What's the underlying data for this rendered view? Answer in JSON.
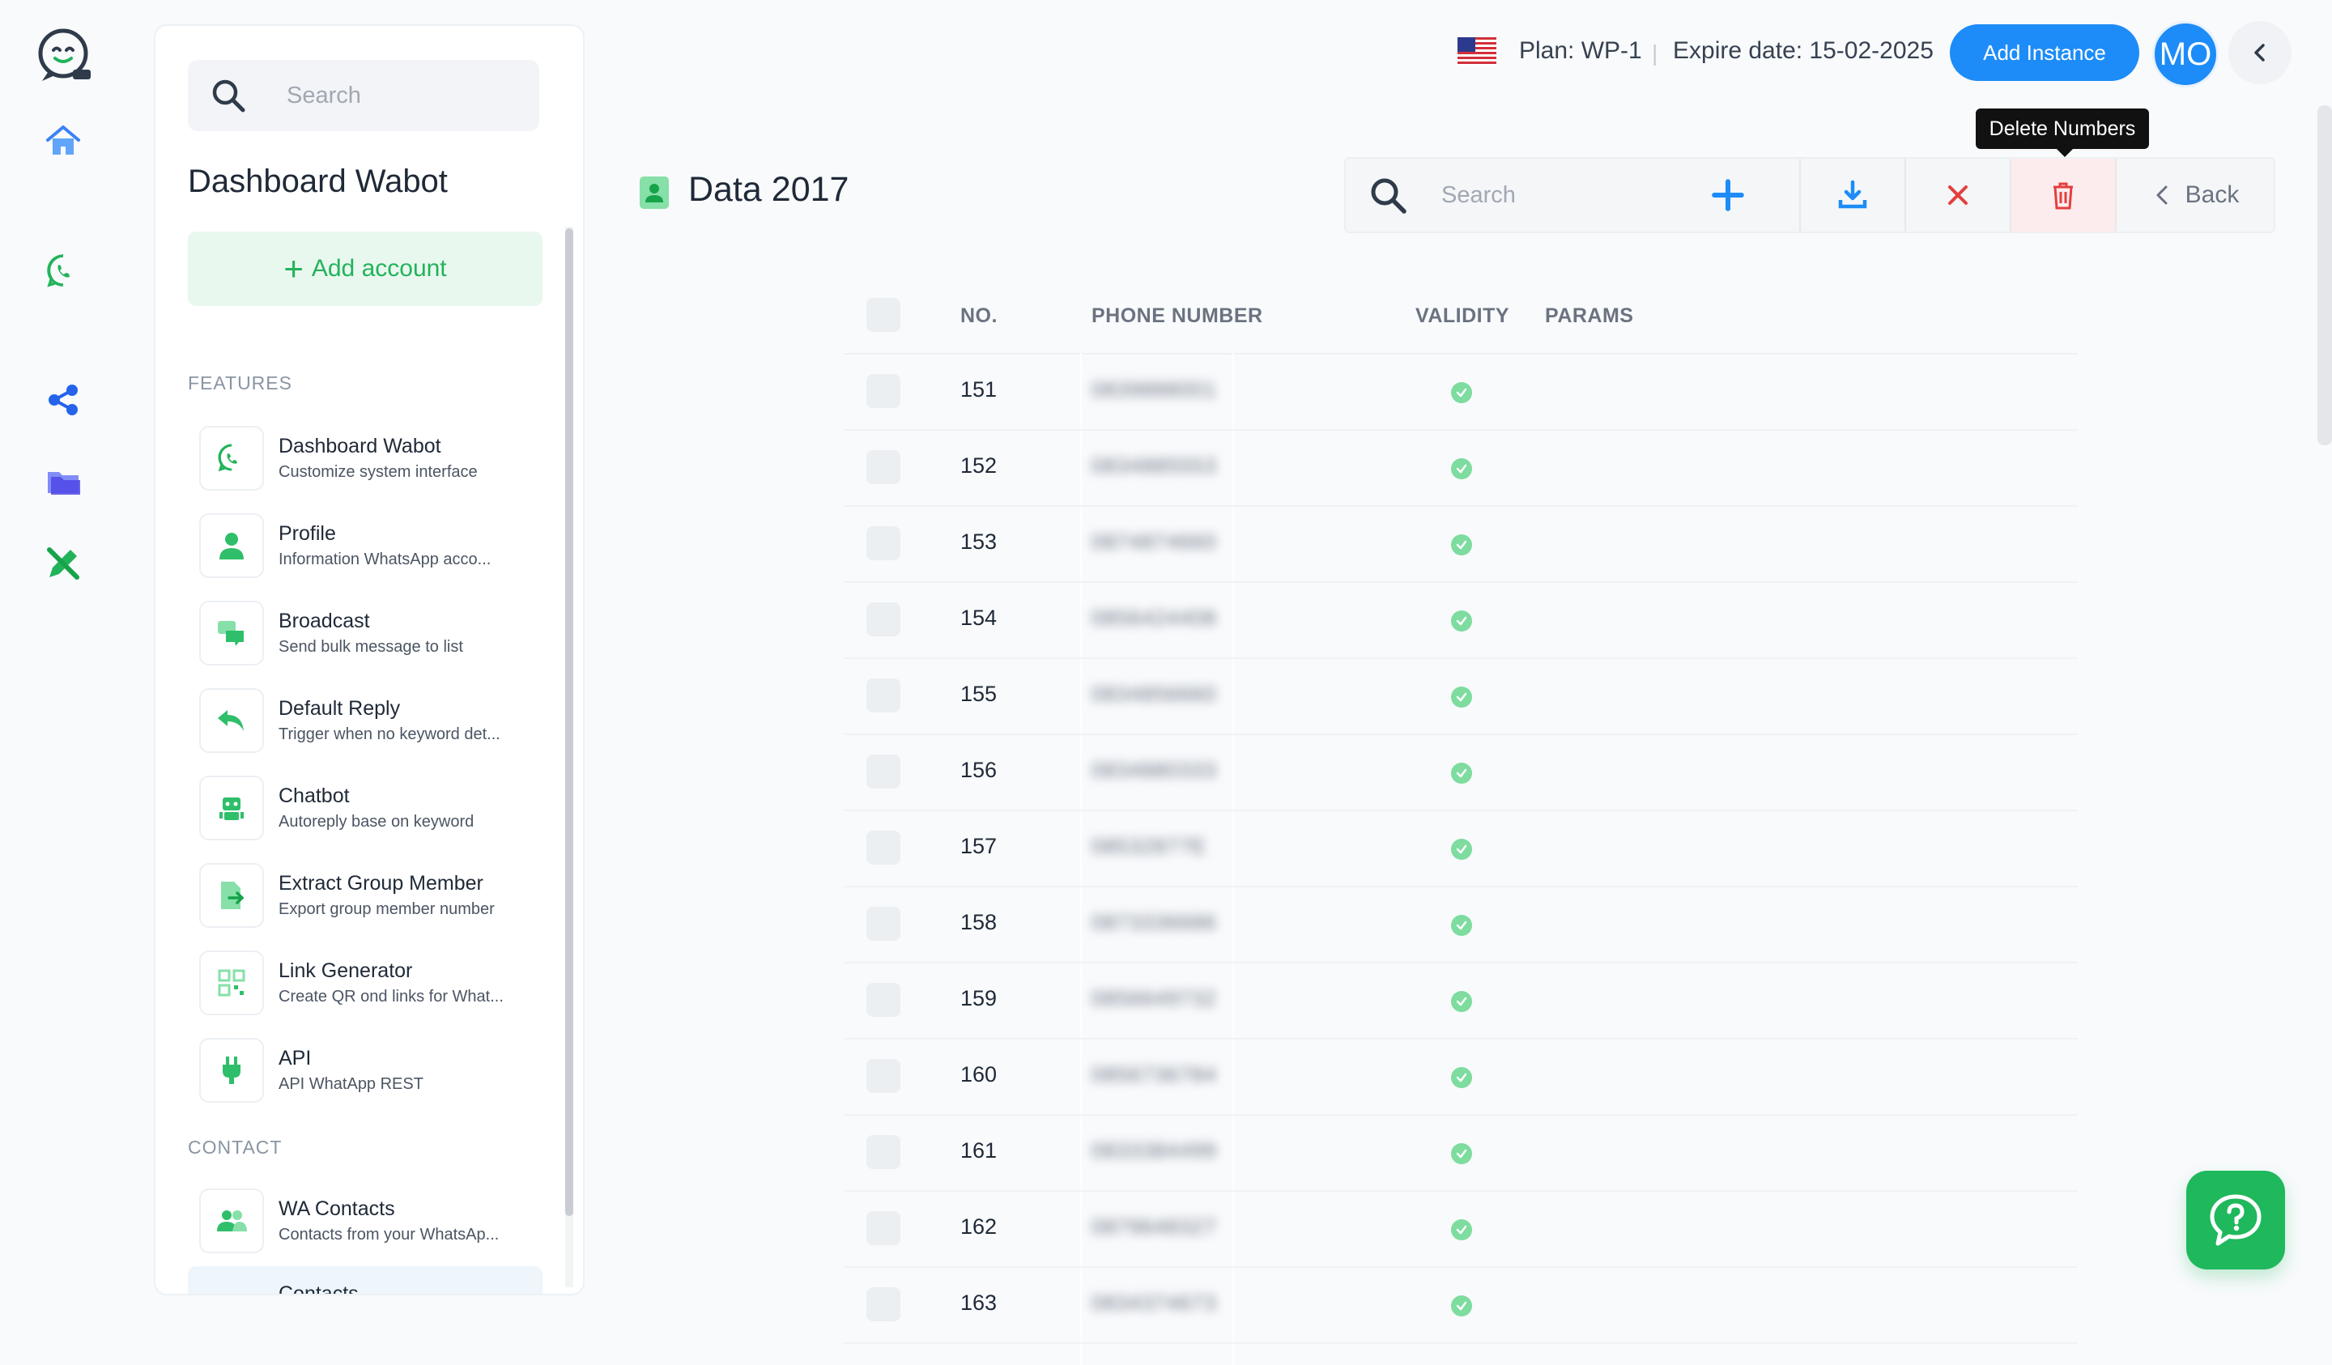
{
  "topbar": {
    "plan": "Plan: WP-1",
    "separator": "|",
    "expire": "Expire date: 15-02-2025",
    "add_instance": "Add Instance",
    "avatar": "MO",
    "tooltip": "Delete Numbers"
  },
  "sidebar": {
    "search_placeholder": "Search",
    "title": "Dashboard Wabot",
    "add_account": "Add account",
    "features_label": "FEATURES",
    "features": [
      {
        "title": "Dashboard Wabot",
        "sub": "Customize system interface",
        "icon": "whatsapp-icon"
      },
      {
        "title": "Profile",
        "sub": "Information WhatsApp acco...",
        "icon": "user-icon"
      },
      {
        "title": "Broadcast",
        "sub": "Send bulk message to list",
        "icon": "chat-bubbles-icon"
      },
      {
        "title": "Default Reply",
        "sub": "Trigger when no keyword det...",
        "icon": "reply-icon"
      },
      {
        "title": "Chatbot",
        "sub": "Autoreply base on keyword",
        "icon": "robot-icon"
      },
      {
        "title": "Extract Group Member",
        "sub": "Export group member number",
        "icon": "file-export-icon"
      },
      {
        "title": "Link Generator",
        "sub": "Create QR ond links for What...",
        "icon": "qr-code-icon"
      },
      {
        "title": "API",
        "sub": "API WhatApp REST",
        "icon": "plug-icon"
      }
    ],
    "contact_label": "CONTACT",
    "contacts": [
      {
        "title": "WA Contacts",
        "sub": "Contacts from your WhatsAp...",
        "icon": "users-icon"
      },
      {
        "title": "Contacts",
        "sub": "",
        "icon": "contacts-icon"
      }
    ]
  },
  "page": {
    "title": "Data 2017",
    "toolbar": {
      "search_placeholder": "Search",
      "back": "Back"
    }
  },
  "table": {
    "headers": [
      "NO.",
      "PHONE NUMBER",
      "VALIDITY",
      "PARAMS"
    ],
    "rows": [
      {
        "no": "151",
        "phone": "0839888001"
      },
      {
        "no": "152",
        "phone": "0834885553"
      },
      {
        "no": "153",
        "phone": "0874874660"
      },
      {
        "no": "154",
        "phone": "0856424408"
      },
      {
        "no": "155",
        "phone": "0834856660"
      },
      {
        "no": "156",
        "phone": "0834880333"
      },
      {
        "no": "157",
        "phone": "08532877E"
      },
      {
        "no": "158",
        "phone": "0873336686"
      },
      {
        "no": "159",
        "phone": "0856649732"
      },
      {
        "no": "160",
        "phone": "0856736784"
      },
      {
        "no": "161",
        "phone": "0833384499"
      },
      {
        "no": "162",
        "phone": "0879648327"
      },
      {
        "no": "163",
        "phone": "0834374673"
      }
    ]
  },
  "colors": {
    "accent_blue": "#1d8cf8",
    "accent_green": "#22b35a",
    "danger": "#e53e3e"
  }
}
